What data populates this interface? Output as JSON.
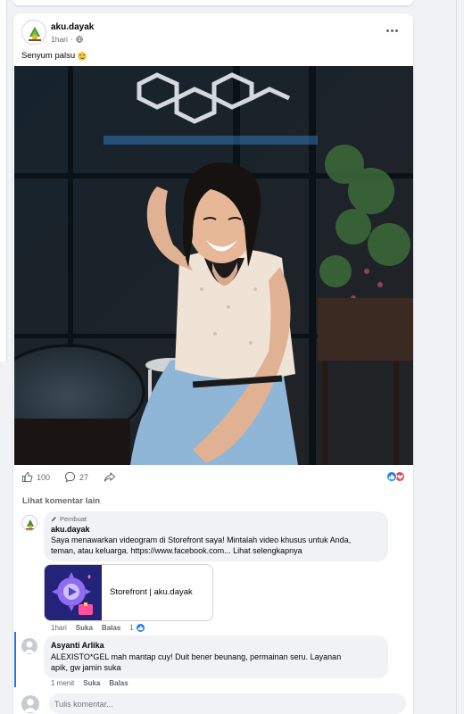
{
  "post": {
    "author": "aku.dayak",
    "time": "1hari",
    "caption": "Senyum palsu",
    "likes_count": "100",
    "comments_count": "27",
    "more_icon": "more-horizontal-icon",
    "audience_icon": "globe-icon"
  },
  "comments_section": {
    "view_more_label": "Lihat komentar lain",
    "comments": [
      {
        "badge": "Pembuat",
        "author": "aku.dayak",
        "text_lines": [
          "Saya menawarkan videogram di Storefront saya! Mintalah video khusus untuk Anda,",
          "teman, atau keluarga. https://www.facebook.com... Lihat selengkapnya"
        ],
        "link_card_title": "Storefront | aku.dayak",
        "time": "1hari",
        "like_label": "Suka",
        "reply_label": "Balas",
        "reaction_count": "1"
      },
      {
        "author": "Asyanti Arlika",
        "text_lines": [
          "ALEXISTO*GEL mah mantap cuy! Duit bener beunang, permainan seru. Layanan",
          "apik, gw jamin suka"
        ],
        "time": "1 menit",
        "like_label": "Suka",
        "reply_label": "Balas"
      }
    ],
    "composer_placeholder": "Tulis komentar..."
  },
  "colors": {
    "accent": "#1877f2",
    "love": "#f33e58",
    "muted_text": "#65676b",
    "bubble_bg": "#f0f2f5"
  }
}
